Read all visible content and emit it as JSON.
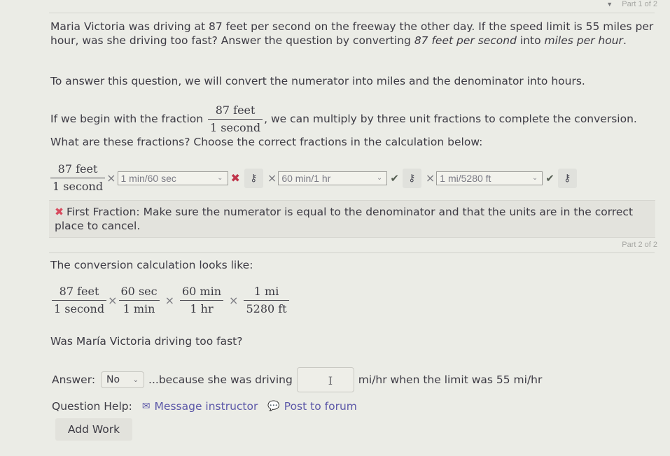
{
  "part1": {
    "header_label": "Part 1 of 2",
    "collapse_glyph": "▼",
    "problem": {
      "text_a": "Maria Victoria was driving at 87 feet per second on the freeway the other day. If the speed limit is 55 miles per hour, was she driving too fast? Answer the question by converting ",
      "emph_1": "87 feet per second",
      "text_b": " into ",
      "emph_2": "miles per hour",
      "text_c": "."
    },
    "plan": "To answer this question, we will convert the numerator into miles and the denominator into hours.",
    "instruction": {
      "text_a": "If we begin with the fraction",
      "fraction": {
        "num": "87 feet",
        "den": "1 second"
      },
      "text_b": ", we can multiply by three unit fractions to complete the conversion. What are these fractions? Choose the correct fractions in the calculation below:"
    },
    "calculation": {
      "start_fraction": {
        "num": "87 feet",
        "den": "1 second"
      },
      "times": "×",
      "selects": [
        {
          "value": "1 min/60 sec",
          "status": "incorrect",
          "status_glyph": "✖"
        },
        {
          "value": "60 min/1 hr",
          "status": "correct",
          "status_glyph": "✔"
        },
        {
          "value": "1 mi/5280 ft",
          "status": "correct",
          "status_glyph": "✔"
        }
      ],
      "key_icon_glyph": "⚷",
      "chevron_glyph": "⌄"
    },
    "feedback": {
      "icon_glyph": "✖",
      "text": "First Fraction: Make sure the numerator is equal to the denominator and that the units are in the correct place to cancel.",
      "color": "#d74a5e"
    }
  },
  "part2": {
    "header_label": "Part 2 of 2",
    "intro": "The conversion calculation looks like:",
    "fractions": [
      {
        "num": "87 feet",
        "den": "1 second"
      },
      {
        "num": "60 sec",
        "den": "1 min"
      },
      {
        "num": "60 min",
        "den": "1 hr"
      },
      {
        "num": "1 mi",
        "den": "5280 ft"
      }
    ],
    "times": "×",
    "question": "Was María Victoria driving too fast?",
    "answer": {
      "label": "Answer:",
      "select_value": "No",
      "chevron_glyph": "⌄",
      "text_a": "...because she was driving",
      "input_value": "",
      "cursor_glyph": "I",
      "text_b": "mi/hr when the limit was 55 mi/hr"
    },
    "help": {
      "label": "Question Help:",
      "message_icon": "✉",
      "message_label": "Message instructor",
      "forum_icon": "💬",
      "forum_label": "Post to forum"
    },
    "add_work_label": "Add Work"
  },
  "colors": {
    "background": "#ebece6",
    "link": "#5c58a8",
    "incorrect": "#c0354b",
    "correct": "#555e52"
  }
}
